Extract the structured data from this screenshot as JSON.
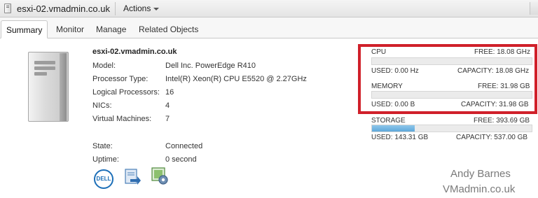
{
  "header": {
    "title": "esxi-02.vmadmin.co.uk",
    "actions_label": "Actions"
  },
  "tabs": [
    {
      "label": "Summary"
    },
    {
      "label": "Monitor"
    },
    {
      "label": "Manage"
    },
    {
      "label": "Related Objects"
    }
  ],
  "host": {
    "name": "esxi-02.vmadmin.co.uk",
    "properties": [
      {
        "label": "Model:",
        "value": "Dell Inc. PowerEdge R410"
      },
      {
        "label": "Processor Type:",
        "value": "Intel(R) Xeon(R) CPU E5520 @ 2.27GHz"
      },
      {
        "label": "Logical Processors:",
        "value": "16"
      },
      {
        "label": "NICs:",
        "value": "4"
      },
      {
        "label": "Virtual Machines:",
        "value": "7"
      },
      {
        "label": "State:",
        "value": "Connected"
      },
      {
        "label": "Uptime:",
        "value": "0 second"
      }
    ]
  },
  "icons": {
    "dell_text": "DELL"
  },
  "resources": {
    "cpu": {
      "label": "CPU",
      "free": "FREE: 18.08 GHz",
      "used": "USED: 0.00 Hz",
      "capacity": "CAPACITY: 18.08 GHz",
      "used_fraction": 0.0
    },
    "memory": {
      "label": "MEMORY",
      "free": "FREE: 31.98 GB",
      "used": "USED: 0.00 B",
      "capacity": "CAPACITY: 31.98 GB",
      "used_fraction": 0.0
    },
    "storage": {
      "label": "STORAGE",
      "free": "FREE: 393.69 GB",
      "used": "USED: 143.31 GB",
      "capacity": "CAPACITY: 537.00 GB",
      "used_fraction": 0.267
    }
  },
  "watermark": {
    "line1": "Andy Barnes",
    "line2": "VMadmin.co.uk"
  },
  "colors": {
    "highlight": "#d0202a",
    "storage_bar": "#5ea8da",
    "dell_blue": "#1d6fb8"
  }
}
